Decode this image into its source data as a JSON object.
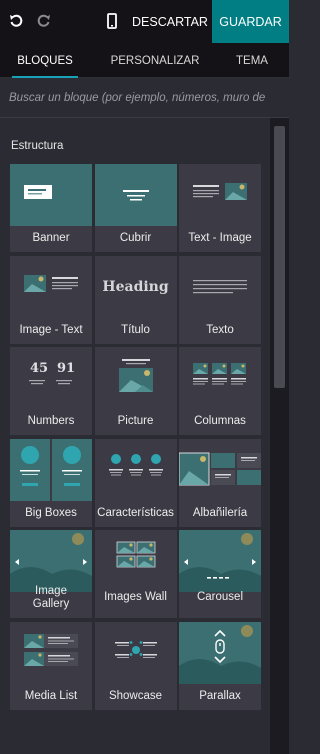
{
  "toolbar": {
    "undo_icon": "undo-icon",
    "redo_icon": "redo-icon",
    "mobile_icon": "mobile-preview-icon",
    "discard_label": "DESCARTAR",
    "save_label": "GUARDAR",
    "save_color": "#017e84"
  },
  "tabs": [
    {
      "label": "BLOQUES",
      "active": true
    },
    {
      "label": "PERSONALIZAR",
      "active": false
    },
    {
      "label": "TEMA",
      "active": false
    }
  ],
  "search": {
    "placeholder": "Buscar un bloque (por ejemplo, números, muro de imágenes...)"
  },
  "section": {
    "title": "Estructura"
  },
  "blocks": [
    {
      "label": "Banner",
      "icon": "banner-thumbnail"
    },
    {
      "label": "Cubrir",
      "icon": "cover-thumbnail"
    },
    {
      "label": "Text - Image",
      "icon": "text-image-thumbnail"
    },
    {
      "label": "Image - Text",
      "icon": "image-text-thumbnail"
    },
    {
      "label": "Título",
      "icon": "heading-thumbnail",
      "preview_text": "Heading"
    },
    {
      "label": "Texto",
      "icon": "text-thumbnail"
    },
    {
      "label": "Numbers",
      "icon": "numbers-thumbnail",
      "preview_values": [
        "45",
        "91"
      ]
    },
    {
      "label": "Picture",
      "icon": "picture-thumbnail"
    },
    {
      "label": "Columnas",
      "icon": "columns-thumbnail"
    },
    {
      "label": "Big Boxes",
      "icon": "big-boxes-thumbnail"
    },
    {
      "label": "Características",
      "icon": "features-thumbnail"
    },
    {
      "label": "Albañilería",
      "icon": "masonry-thumbnail"
    },
    {
      "label": "Image Gallery",
      "icon": "image-gallery-thumbnail"
    },
    {
      "label": "Images Wall",
      "icon": "images-wall-thumbnail"
    },
    {
      "label": "Carousel",
      "icon": "carousel-thumbnail"
    },
    {
      "label": "Media List",
      "icon": "media-list-thumbnail"
    },
    {
      "label": "Showcase",
      "icon": "showcase-thumbnail"
    },
    {
      "label": "Parallax",
      "icon": "parallax-thumbnail"
    }
  ],
  "colors": {
    "accent": "#17a2b8",
    "teal_thumb": "#3b6f72",
    "panel_bg": "#2b2b33",
    "block_bg": "#3c3b45"
  }
}
